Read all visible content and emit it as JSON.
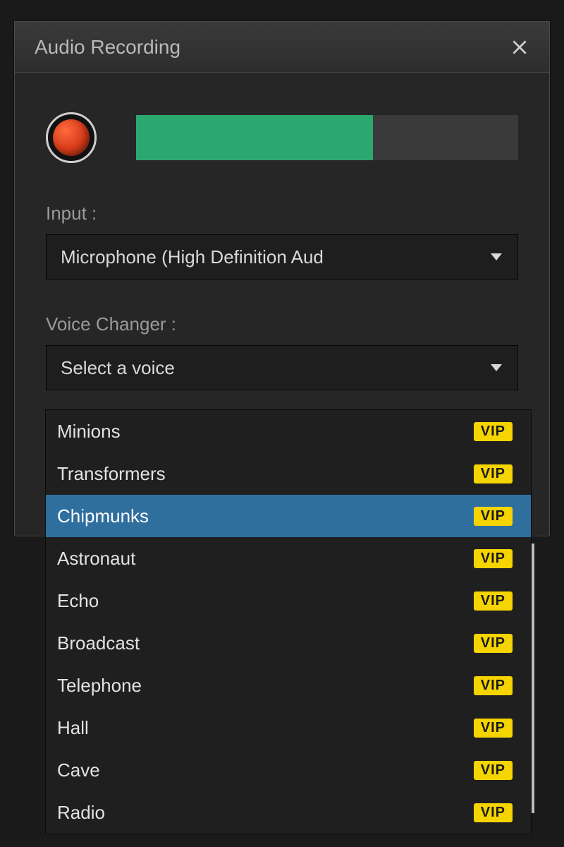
{
  "dialog": {
    "title": "Audio Recording"
  },
  "level": {
    "fill_percent": 62
  },
  "input": {
    "label": "Input :",
    "value": "Microphone (High Definition Aud"
  },
  "voice_changer": {
    "label": "Voice Changer :",
    "placeholder": "Select a voice",
    "items": [
      {
        "label": "Minions",
        "vip": "VIP",
        "selected": false
      },
      {
        "label": "Transformers",
        "vip": "VIP",
        "selected": false
      },
      {
        "label": "Chipmunks",
        "vip": "VIP",
        "selected": true
      },
      {
        "label": "Astronaut",
        "vip": "VIP",
        "selected": false
      },
      {
        "label": "Echo",
        "vip": "VIP",
        "selected": false
      },
      {
        "label": "Broadcast",
        "vip": "VIP",
        "selected": false
      },
      {
        "label": "Telephone",
        "vip": "VIP",
        "selected": false
      },
      {
        "label": "Hall",
        "vip": "VIP",
        "selected": false
      },
      {
        "label": "Cave",
        "vip": "VIP",
        "selected": false
      },
      {
        "label": "Radio",
        "vip": "VIP",
        "selected": false
      }
    ]
  },
  "colors": {
    "accent_green": "#2aa86f",
    "record_red": "#d63b1a",
    "selected_blue": "#2f6f9e",
    "vip_yellow": "#f5d400"
  }
}
